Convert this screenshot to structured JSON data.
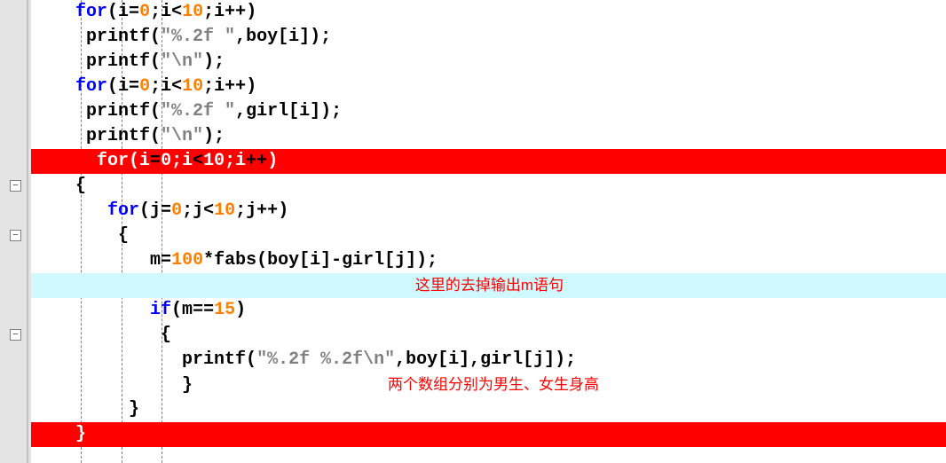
{
  "code": {
    "l1": {
      "pre": "    ",
      "kw": "for",
      "body1": "(i",
      "eq1": "=",
      "n0a": "0",
      "semi1": ";",
      "body2": "i",
      "lt": "<",
      "n10": "10",
      "semi2": ";",
      "body3": "i",
      "inc": "++",
      ")end": ")"
    },
    "l2": {
      "pre": "     ",
      "fn": "printf",
      "paren": "(",
      "str": "\"%.2f \"",
      "comma": ",",
      "arr": "boy",
      "br": "[",
      "idx": "i",
      "brc": "]);"
    },
    "l3": {
      "pre": "     ",
      "fn": "printf",
      "paren": "(",
      "str": "\"\\n\"",
      "end": ");"
    },
    "l4": {
      "pre": "    ",
      "kw": "for",
      "body1": "(i",
      "eq1": "=",
      "n0": "0",
      "semi1": ";",
      "body2": "i",
      "lt": "<",
      "n10": "10",
      "semi2": ";",
      "body3": "i",
      "inc": "++",
      ")end": ")"
    },
    "l5": {
      "pre": "     ",
      "fn": "printf",
      "paren": "(",
      "str": "\"%.2f \"",
      "comma": ",",
      "arr": "girl",
      "br": "[",
      "idx": "i",
      "brc": "]);"
    },
    "l6": {
      "pre": "     ",
      "fn": "printf",
      "paren": "(",
      "str": "\"\\n\"",
      "end": ");"
    },
    "l7": {
      "pre": "      ",
      "kw": "for",
      "open": "(i",
      "eq": "=",
      "n0": "0",
      "s1": ";",
      "v2": "i",
      "lt": "<",
      "n10": "10",
      "s2": ";",
      "v3": "i",
      "inc": "++",
      ")end": ")"
    },
    "l8": {
      "pre": "    ",
      "brace": "{"
    },
    "l9": {
      "pre": "       ",
      "kw": "for",
      "open": "(j",
      "eq": "=",
      "n0": "0",
      "s1": ";",
      "v2": "j",
      "lt": "<",
      "n10": "10",
      "s2": ";",
      "v3": "j",
      "inc": "++",
      ")end": ")"
    },
    "l10": {
      "pre": "        ",
      "brace": "{"
    },
    "l11": {
      "pre": "           ",
      "lhs": "m",
      "eq": "=",
      "n100": "100",
      "mul": "*",
      "fn": "fabs",
      "args": "(boy[i]",
      "minus": "-",
      "args2": "girl[j]);"
    },
    "l12": {
      "annot": "这里的去掉输出m语句"
    },
    "l13": {
      "pre": "           ",
      "kw": "if",
      "cond": "(m",
      "eq": "==",
      "n15": "15",
      "end": ")"
    },
    "l14": {
      "pre": "            ",
      "brace": "{"
    },
    "l15": {
      "pre": "              ",
      "fn": "printf",
      "paren": "(",
      "str": "\"%.2f %.2f\\n\"",
      "comma": ",",
      "a1": "boy[i]",
      ",c2": ",",
      "a2": "girl[j]);"
    },
    "l16": {
      "pre": "              ",
      "brace": "}",
      "annot": "两个数组分别为男生、女生身高"
    },
    "l17": {
      "pre": "         ",
      "brace": "}"
    },
    "l18": {
      "pre": "    ",
      "brace": "}"
    }
  },
  "fold_symbol": "−"
}
